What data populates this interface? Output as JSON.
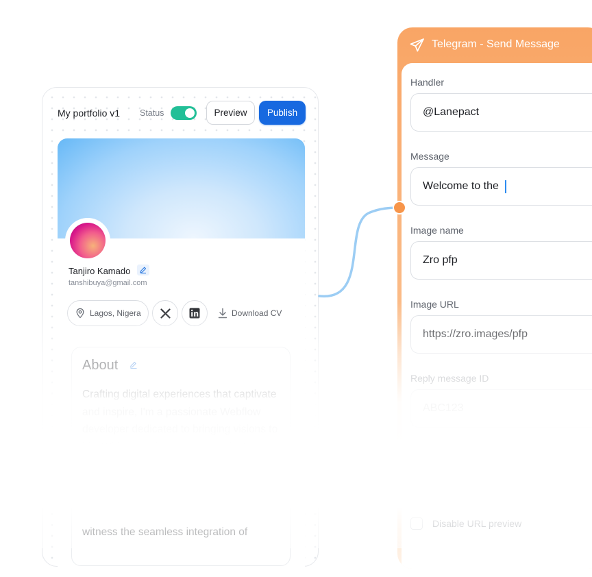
{
  "portfolio": {
    "title": "My portfolio v1",
    "status_label": "Status",
    "status_on": true,
    "preview_label": "Preview",
    "publish_label": "Publish",
    "colors": {
      "publish": "#1769e0",
      "toggle": "#22bf97"
    },
    "profile": {
      "name": "Tanjiro Kamado",
      "email": "tanshibuya@gmail.com",
      "location": "Lagos, Nigera",
      "download_label": "Download CV",
      "social_icons": [
        "x-icon",
        "linkedin-icon"
      ]
    },
    "about": {
      "title": "About",
      "text": "Crafting digital experiences that captivate and inspire, I'm a passionate Webflow developer dedicated to bringing visions to life. With expertise in creating sleek, responsive websites",
      "text_end": "witness the seamless integration of"
    }
  },
  "telegram": {
    "title": "Telegram - Send Message",
    "icon": "paper-plane-icon",
    "accent": "#f7954a",
    "fields": [
      {
        "label": "Handler",
        "value": "@Lanepact"
      },
      {
        "label": "Message",
        "value": "Welcome to the "
      },
      {
        "label": "Image name",
        "value": "Zro pfp"
      },
      {
        "label": "Image URL",
        "value": "https://zro.images/pfp"
      },
      {
        "label": "Reply message ID",
        "value": "ABC123"
      }
    ],
    "checkbox_label": "Disable URL preview"
  }
}
